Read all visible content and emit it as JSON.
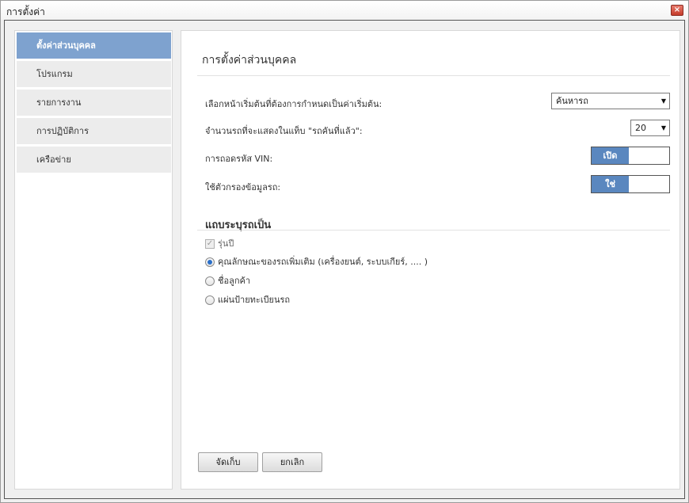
{
  "window": {
    "title": "การตั้งค่า",
    "close_glyph": "×"
  },
  "sidebar": {
    "items": [
      {
        "label": "ตั้งค่าส่วนบุคคล",
        "active": true
      },
      {
        "label": "โปรแกรม",
        "active": false
      },
      {
        "label": "รายการงาน",
        "active": false
      },
      {
        "label": "การปฏิบัติการ",
        "active": false
      },
      {
        "label": "เครือข่าย",
        "active": false
      }
    ]
  },
  "content": {
    "title": "การตั้งค่าส่วนบุคคล",
    "start_page": {
      "label": "เลือกหน้าเริ่มต้นที่ต้องการกำหนดเป็นค่าเริ่มต้น:",
      "value": "ค้นหารถ"
    },
    "history_count": {
      "label": "จำนวนรถที่จะแสดงในแท็บ \"รถคันที่แล้ว\":",
      "value": "20"
    },
    "vin_decode": {
      "label": "การถอดรหัส VIN:",
      "state": "เปิด"
    },
    "vehicle_filter": {
      "label": "ใช้ตัวกรองข้อมูลรถ:",
      "state": "ใช่"
    },
    "identify_section": {
      "title": "แถบระบุรถเป็น",
      "checkbox_label": "รุ่นปี",
      "options": [
        {
          "label": "คุณลักษณะของรถเพิ่มเติม (เครื่องยนต์, ระบบเกียร์, .... )",
          "checked": true
        },
        {
          "label": "ชื่อลูกค้า",
          "checked": false
        },
        {
          "label": "แผ่นป้ายทะเบียนรถ",
          "checked": false
        }
      ]
    },
    "buttons": {
      "save": "จัดเก็บ",
      "cancel": "ยกเลิก"
    }
  },
  "colors": {
    "accent": "#7ea2cf",
    "toggle_on": "#5a87bf",
    "radio_dot": "#2a6fc9"
  },
  "icons": {
    "close": "close-icon",
    "dropdown": "chevron-down-icon"
  }
}
